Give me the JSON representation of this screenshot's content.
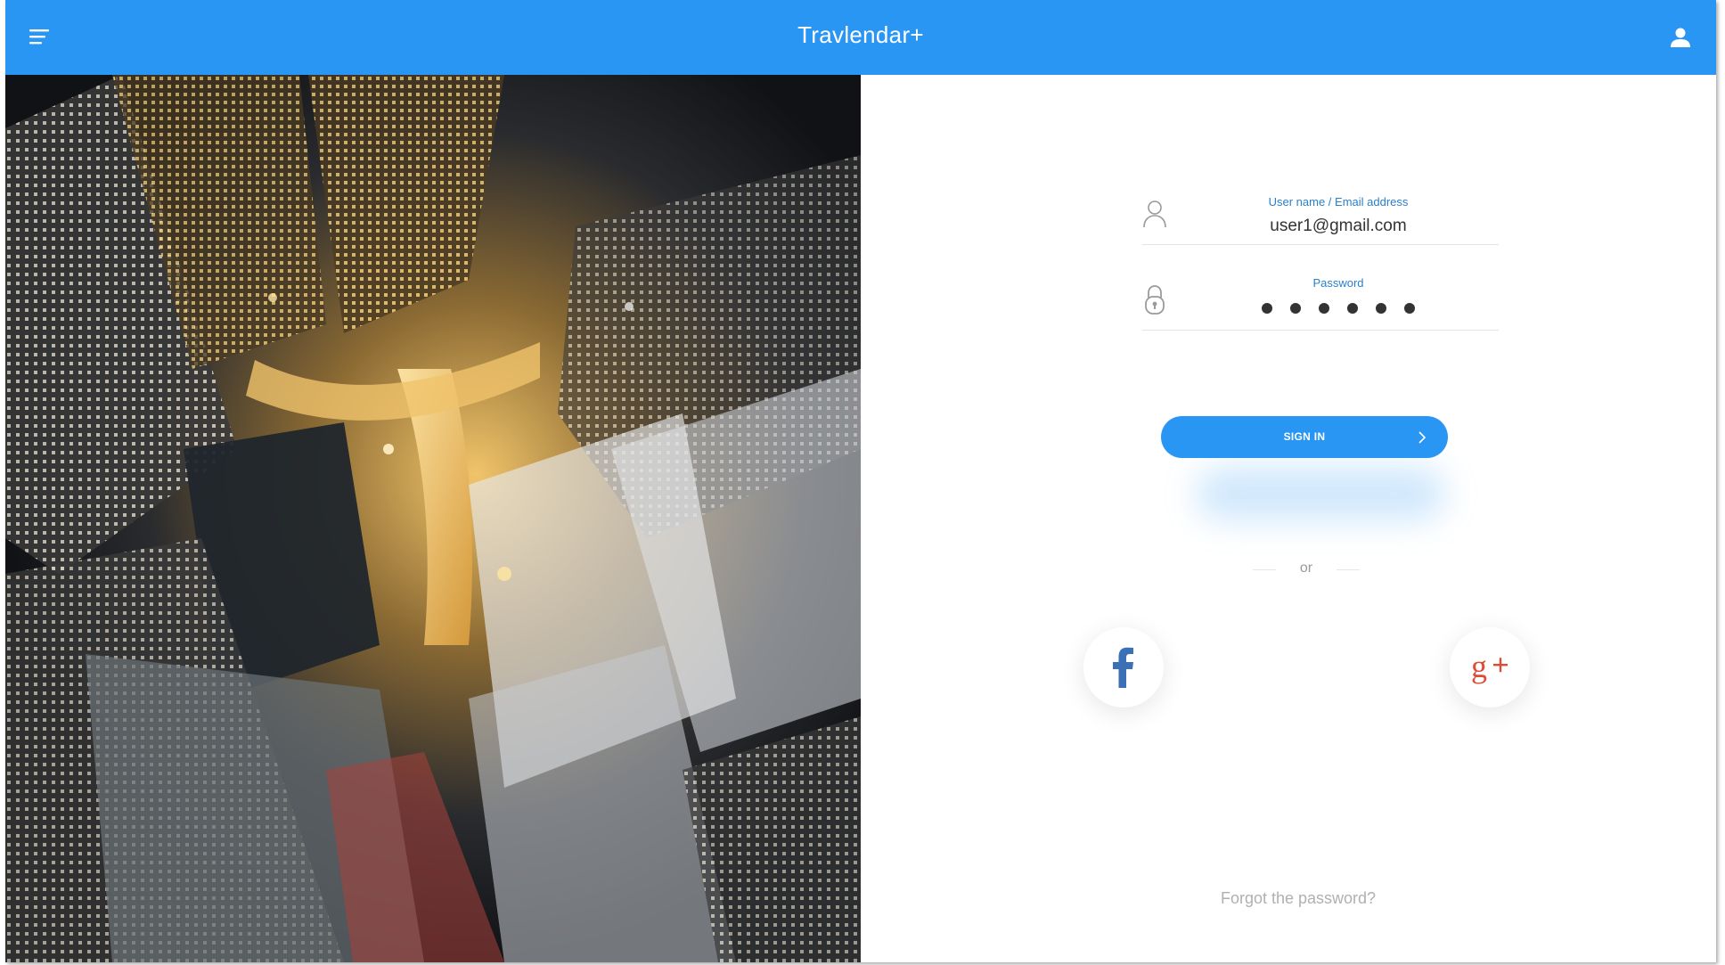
{
  "app": {
    "title": "Travlendar+"
  },
  "topbar": {
    "color": "#2a96f3",
    "menu_icon": "hamburger-menu-icon",
    "profile_icon": "user-profile-icon"
  },
  "login": {
    "username": {
      "label": "User name / Email address",
      "value": "user1@gmail.com",
      "icon": "user-outline-icon"
    },
    "password": {
      "label": "Password",
      "masked_length": 6,
      "icon": "padlock-icon"
    },
    "signin_label": "SIGN IN",
    "signin_icon": "chevron-right-icon",
    "divider_text": "or",
    "social": [
      {
        "name": "facebook",
        "icon": "facebook-icon",
        "color": "#3b6fb6"
      },
      {
        "name": "google-plus",
        "icon": "google-plus-icon",
        "color": "#dd4b39"
      }
    ],
    "forgot_label": "Forgot the password?"
  },
  "hero_image": {
    "description_icon": "city-aerial-night-photo"
  }
}
